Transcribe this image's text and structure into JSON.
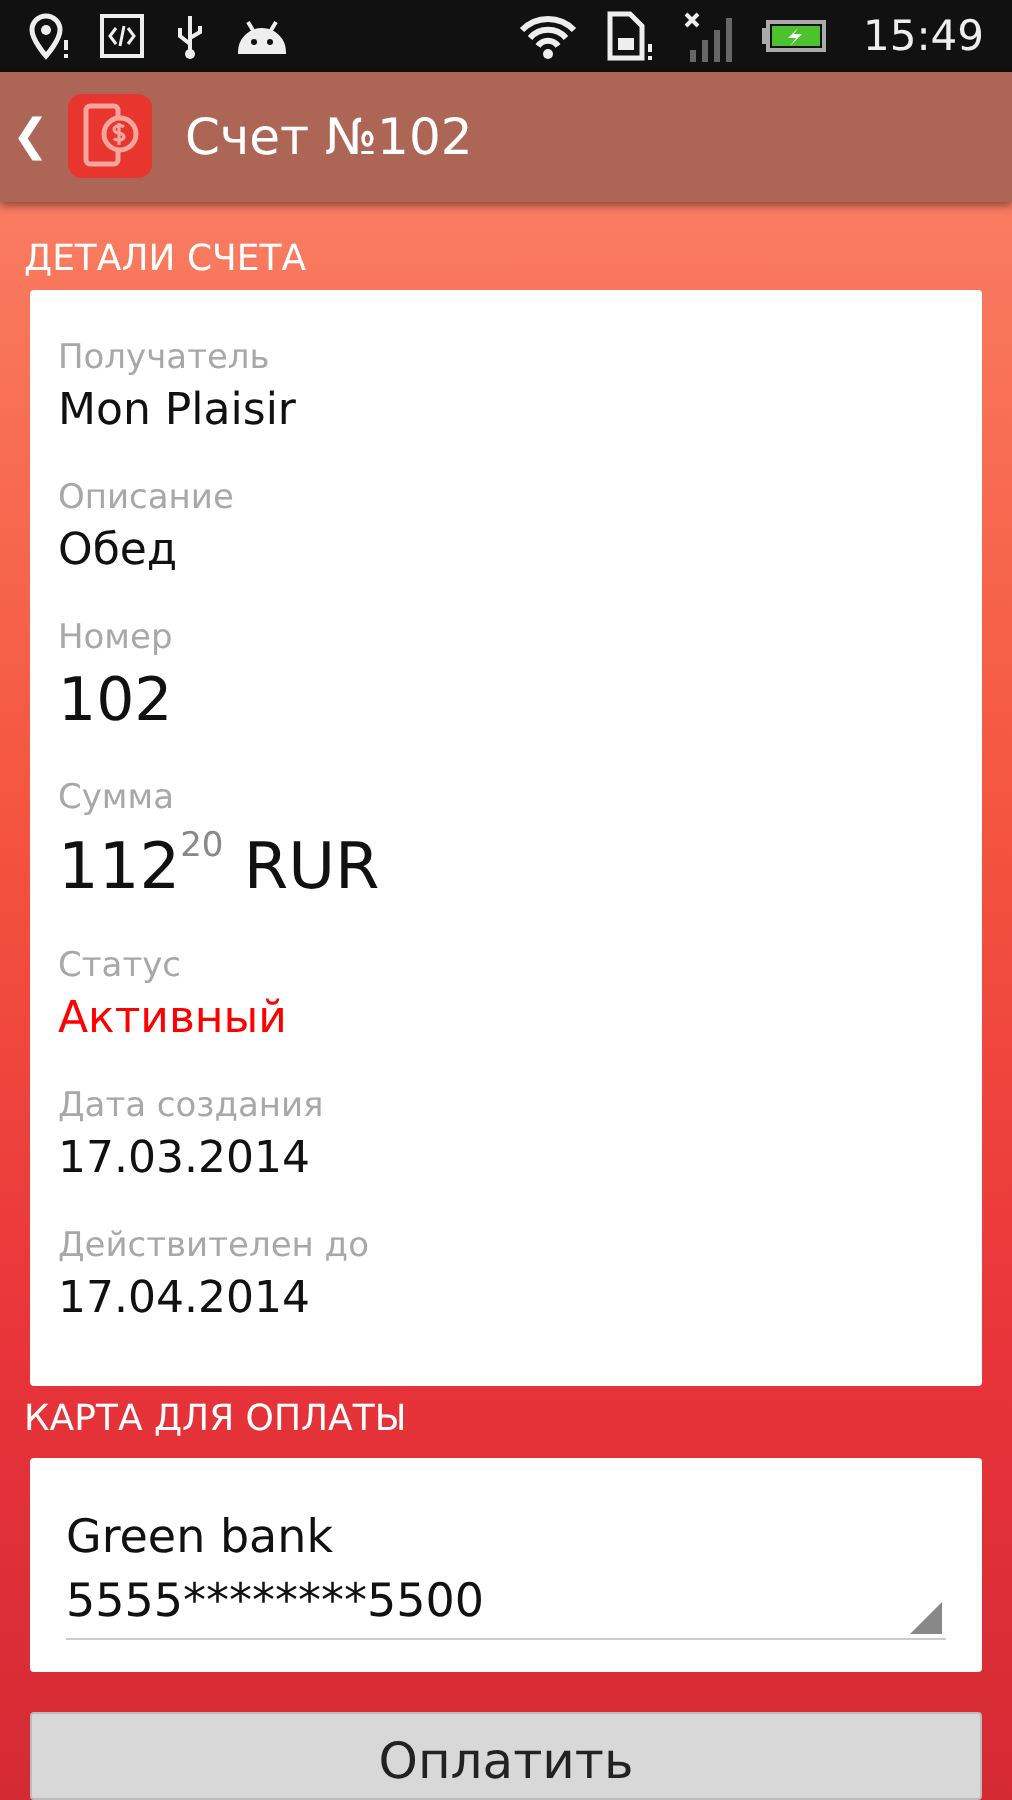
{
  "status_bar": {
    "time": "15:49",
    "battery_charging": true
  },
  "action_bar": {
    "back": "❮",
    "title": "Счет №102"
  },
  "details": {
    "header": "ДЕТАЛИ СЧЕТА",
    "fields": [
      {
        "kind": "text",
        "label": "Получатель",
        "value": "Mon Plaisir"
      },
      {
        "kind": "text",
        "label": "Описание",
        "value": "Обед"
      },
      {
        "kind": "large",
        "label": "Номер",
        "value": "102"
      },
      {
        "kind": "amount",
        "label": "Сумма",
        "value": "112$^{20}$ RUR"
      },
      {
        "kind": "status",
        "label": "Статус",
        "value": "Активный"
      },
      {
        "kind": "text",
        "label": "Дата создания",
        "value": "17.03.2014"
      },
      {
        "kind": "text",
        "label": "Действителен до",
        "value": "17.04.2014"
      }
    ]
  },
  "payment": {
    "header": "КАРТА ДЛЯ ОПЛАТЫ",
    "card_name": "Green bank",
    "card_number": "5555********5500"
  },
  "pay_button": "Оплатить"
}
